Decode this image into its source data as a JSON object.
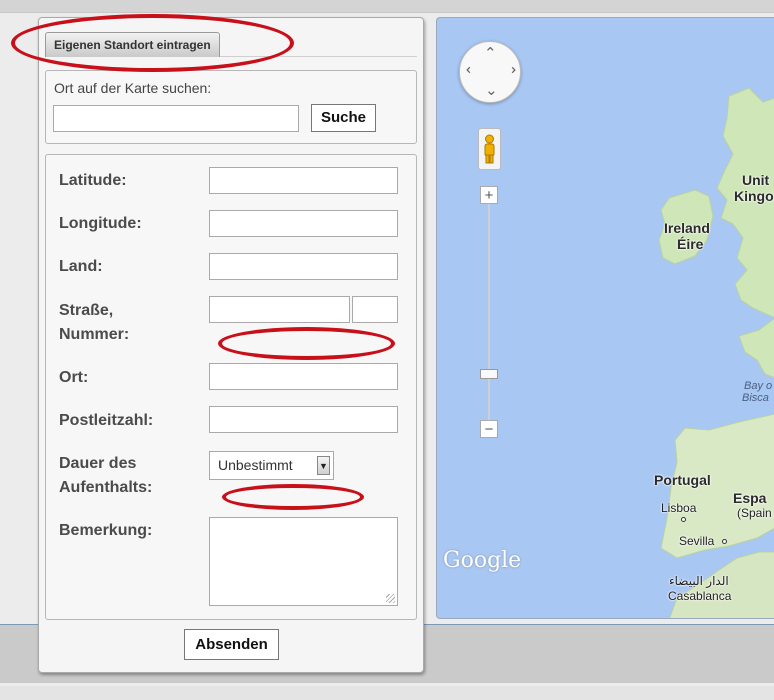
{
  "tab": {
    "label": "Eigenen Standort eintragen"
  },
  "search": {
    "label": "Ort auf der Karte suchen:",
    "button": "Suche",
    "value": ""
  },
  "form": {
    "latitude": "Latitude:",
    "longitude": "Longitude:",
    "land": "Land:",
    "street_line1": "Straße,",
    "street_line2": "Nummer:",
    "ort": "Ort:",
    "plz": "Postleitzahl:",
    "duration_line1": "Dauer des",
    "duration_line2": "Aufenthalts:",
    "duration_value": "Unbestimmt",
    "bemerkung": "Bemerkung:",
    "submit": "Absenden"
  },
  "map": {
    "pan_up": "⌃",
    "zoom_in": "+",
    "zoom_out": "−",
    "labels": {
      "ireland": "Ireland",
      "eire": "Éire",
      "uk1": "Unit",
      "uk2": "Kingo",
      "bay1": "Bay o",
      "bay2": "Bisca",
      "portugal": "Portugal",
      "lisboa": "Lisboa",
      "espana1": "Espa",
      "espana2": "(Spain",
      "sevilla": "Sevilla",
      "casablanca_ar": "الدار البيضاء",
      "casablanca": "Casablanca"
    },
    "logo": "Google"
  },
  "colors": {
    "highlight_oval": "#c8101a",
    "water": "#a9c7f3",
    "land": "#cfe6b8"
  }
}
